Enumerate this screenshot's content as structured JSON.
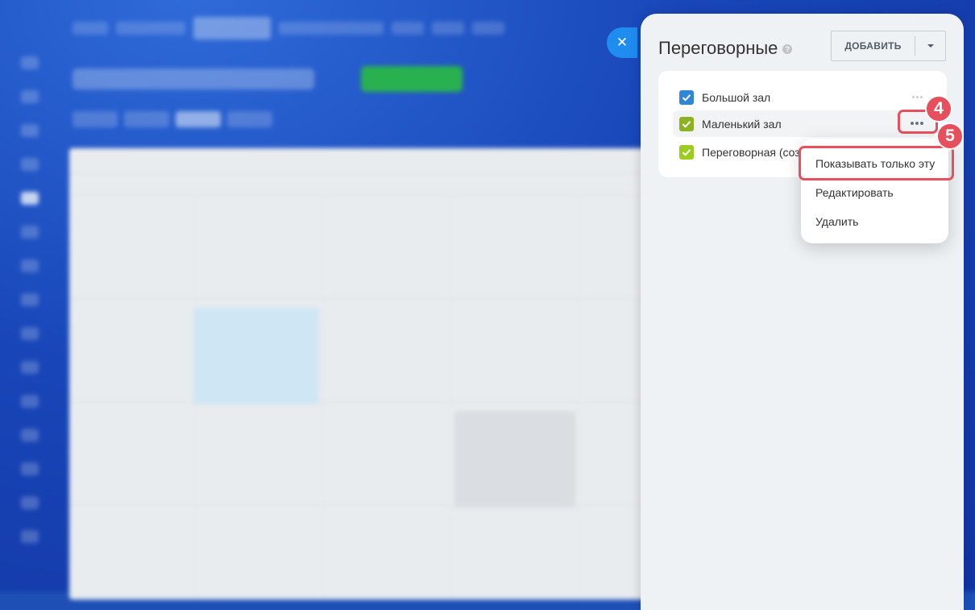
{
  "panel": {
    "title": "Переговорные",
    "help_icon": "question-icon",
    "add_button_label": "ДОБАВИТЬ"
  },
  "rooms": [
    {
      "label": "Большой зал",
      "checked": true,
      "color": "#2f86d4"
    },
    {
      "label": "Маленький зал",
      "checked": true,
      "color": "#8cb21f"
    },
    {
      "label": "Переговорная (созд",
      "checked": true,
      "color": "#9acd1f"
    }
  ],
  "context_menu": {
    "items": [
      "Показывать только эту",
      "Редактировать",
      "Удалить"
    ]
  },
  "step_badges": [
    "4",
    "5"
  ],
  "colors": {
    "accent_blue": "#1f8cf0",
    "highlight_red": "#e6505c"
  }
}
